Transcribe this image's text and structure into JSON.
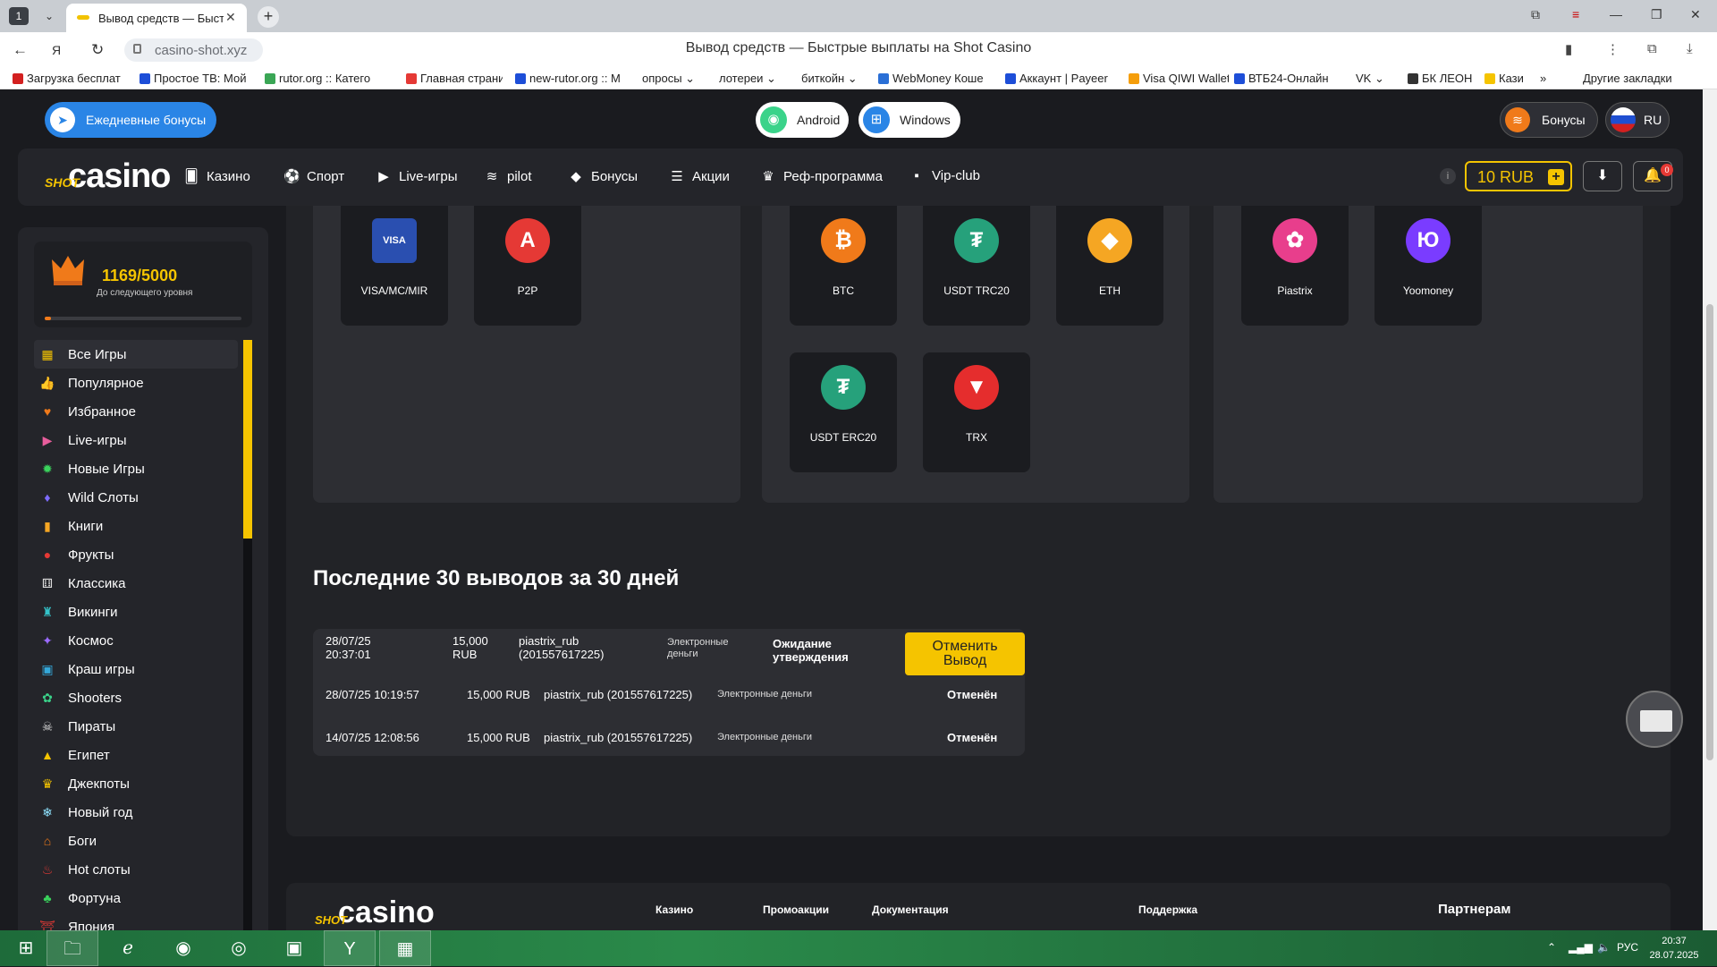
{
  "browser": {
    "tab_count": "1",
    "tab_title": "Вывод средств — Быст",
    "url": "casino-shot.xyz",
    "page_title": "Вывод средств — Быстрые выплаты на Shot Casino",
    "bookmarks": [
      {
        "label": "Загрузка бесплат",
        "color": "#d32020"
      },
      {
        "label": "Простое ТВ: Мой",
        "color": "#1d4ed8"
      },
      {
        "label": "rutor.org :: Катего",
        "color": "#3aa655"
      },
      {
        "label": "Главная страница",
        "color": "#e53935"
      },
      {
        "label": "new-rutor.org :: M",
        "color": "#1d4ed8"
      },
      {
        "label": "опросы ⌄",
        "color": ""
      },
      {
        "label": "лотереи ⌄",
        "color": ""
      },
      {
        "label": "биткойн ⌄",
        "color": ""
      },
      {
        "label": "WebMoney Коше",
        "color": "#2a6fd6"
      },
      {
        "label": "Аккаунт | Payeer",
        "color": "#1d4ed8"
      },
      {
        "label": "Visa QIWI Wallet",
        "color": "#f59e0b"
      },
      {
        "label": "ВТБ24-Онлайн",
        "color": "#1d4ed8"
      },
      {
        "label": "VK ⌄",
        "color": ""
      },
      {
        "label": "БК ЛЕОН",
        "color": "#333333"
      },
      {
        "label": "Кази",
        "color": "#f5c400"
      },
      {
        "label": "»",
        "color": ""
      }
    ],
    "other_bookmarks": "Другие закладки"
  },
  "topbar": {
    "daily_bonus": "Ежедневные бонусы",
    "android": "Android",
    "windows": "Windows",
    "bonuses": "Бонусы",
    "lang": "RU"
  },
  "nav": {
    "logo_shot": "SHOT",
    "logo_casino": "casino",
    "items": [
      {
        "label": "Казино",
        "icon": "🂠"
      },
      {
        "label": "Спорт",
        "icon": "⚽"
      },
      {
        "label": "Live-игры",
        "icon": "▶"
      },
      {
        "label": "pilot",
        "icon": "≋"
      },
      {
        "label": "Бонусы",
        "icon": "◆"
      },
      {
        "label": "Акции",
        "icon": "☰"
      },
      {
        "label": "Реф-программа",
        "icon": "♛"
      },
      {
        "label": "Vip-club",
        "icon": "▪"
      }
    ],
    "balance": "10 RUB",
    "notifications": "0"
  },
  "level": {
    "value": "1169/5000",
    "subtitle": "До следующего уровня",
    "progress": 0.03
  },
  "categories": [
    {
      "label": "Все Игры",
      "icon": "▦",
      "color": "#f5c400"
    },
    {
      "label": "Популярное",
      "icon": "👍",
      "color": "#4aa3ff"
    },
    {
      "label": "Избранное",
      "icon": "♥",
      "color": "#f07a1a"
    },
    {
      "label": "Live-игры",
      "icon": "▶",
      "color": "#e85d9c"
    },
    {
      "label": "Новые Игры",
      "icon": "✹",
      "color": "#3ad35c"
    },
    {
      "label": "Wild Слоты",
      "icon": "♦",
      "color": "#7d6bff"
    },
    {
      "label": "Книги",
      "icon": "▮",
      "color": "#f5a623"
    },
    {
      "label": "Фрукты",
      "icon": "●",
      "color": "#e53935"
    },
    {
      "label": "Классика",
      "icon": "⚅",
      "color": "#dddddd"
    },
    {
      "label": "Викинги",
      "icon": "♜",
      "color": "#34c3c9"
    },
    {
      "label": "Космос",
      "icon": "✦",
      "color": "#9b6bff"
    },
    {
      "label": "Краш игры",
      "icon": "▣",
      "color": "#34a8d9"
    },
    {
      "label": "Shooters",
      "icon": "✿",
      "color": "#3ad38a"
    },
    {
      "label": "Пираты",
      "icon": "☠",
      "color": "#dddddd"
    },
    {
      "label": "Египет",
      "icon": "▲",
      "color": "#f5c400"
    },
    {
      "label": "Джекпоты",
      "icon": "♛",
      "color": "#f5c400"
    },
    {
      "label": "Новый год",
      "icon": "❄",
      "color": "#8fe3ff"
    },
    {
      "label": "Боги",
      "icon": "⌂",
      "color": "#f07a1a"
    },
    {
      "label": "Hot слоты",
      "icon": "♨",
      "color": "#e53935"
    },
    {
      "label": "Фортуна",
      "icon": "♣",
      "color": "#3ad35c"
    },
    {
      "label": "Япония",
      "icon": "⛩",
      "color": "#e53935"
    }
  ],
  "methods": {
    "cards": [
      {
        "label": "VISA/MC/MIR",
        "icon_name": "visa-mc-mir-icon",
        "glyph": "VISA",
        "color": "#2a4fb0"
      },
      {
        "label": "P2P",
        "icon_name": "p2p-icon",
        "glyph": "A",
        "color": "#e53935"
      }
    ],
    "crypto": [
      {
        "label": "BTC",
        "icon_name": "bitcoin-icon",
        "glyph": "₿",
        "color": "#f07a1a"
      },
      {
        "label": "USDT TRC20",
        "icon_name": "usdt-trc20-icon",
        "glyph": "₮",
        "color": "#26a17b"
      },
      {
        "label": "ETH",
        "icon_name": "ethereum-icon",
        "glyph": "◆",
        "color": "#f5a623"
      },
      {
        "label": "USDT ERC20",
        "icon_name": "usdt-erc20-icon",
        "glyph": "₮",
        "color": "#26a17b"
      },
      {
        "label": "TRX",
        "icon_name": "tron-icon",
        "glyph": "▼",
        "color": "#e52d2d"
      }
    ],
    "ewallets": [
      {
        "label": "Piastrix",
        "icon_name": "piastrix-icon",
        "glyph": "✿",
        "color": "#e83e8c"
      },
      {
        "label": "Yoomoney",
        "icon_name": "yoomoney-icon",
        "glyph": "Ю",
        "color": "#7a3cff"
      }
    ]
  },
  "withdrawals": {
    "title": "Последние 30 выводов за 30 дней",
    "rows": [
      {
        "date": "28/07/25",
        "time": "20:37:01",
        "amount": "15,000",
        "currency": "RUB",
        "wallet": "piastrix_rub",
        "wallet_id": "(201557617225)",
        "type_1": "Электронные",
        "type_2": "деньги",
        "status_1": "Ожидание",
        "status_2": "утверждения",
        "action_1": "Отменить",
        "action_2": "Вывод"
      },
      {
        "datetime": "28/07/25 10:19:57",
        "amount": "15,000 RUB",
        "wallet": "piastrix_rub (201557617225)",
        "type": "Электронные деньги",
        "status": "Отменён"
      },
      {
        "datetime": "14/07/25 12:08:56",
        "amount": "15,000 RUB",
        "wallet": "piastrix_rub (201557617225)",
        "type": "Электронные деньги",
        "status": "Отменён"
      }
    ]
  },
  "footer": {
    "logo_shot": "SHOT",
    "logo_casino": "casino",
    "links": [
      "Казино",
      "Промоакции",
      "Документация",
      "Поддержка",
      "Партнерам"
    ]
  },
  "taskbar": {
    "lang": "РУС",
    "time": "20:37",
    "date": "28.07.2025"
  }
}
